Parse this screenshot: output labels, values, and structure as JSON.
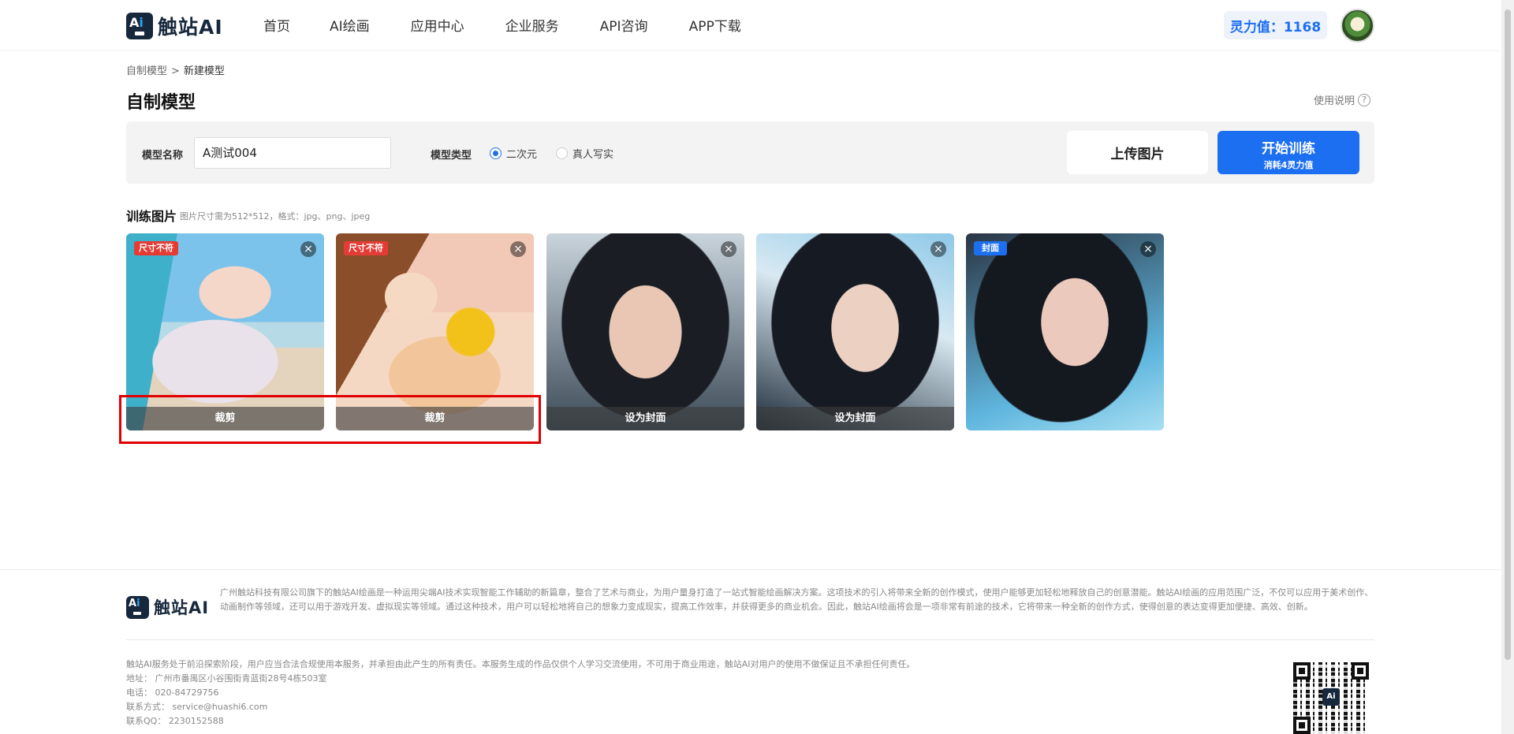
{
  "header": {
    "logo_text": "触站AI",
    "nav": [
      "首页",
      "AI绘画",
      "应用中心",
      "企业服务",
      "API咨询",
      "APP下载"
    ],
    "power_label": "灵力值：1168"
  },
  "breadcrumb": {
    "parent": "自制模型",
    "separator": ">",
    "current": "新建模型"
  },
  "page": {
    "title": "自制模型",
    "usage_link": "使用说明"
  },
  "form": {
    "name_label": "模型名称",
    "name_value": "A测试004",
    "type_label": "模型类型",
    "type_options": [
      "二次元",
      "真人写实"
    ],
    "type_selected": "二次元",
    "upload_label": "上传图片",
    "train_label": "开始训练",
    "train_cost": "消耗4灵力值"
  },
  "training": {
    "title": "训练图片",
    "hint": "图片尺寸需为512*512，格式：jpg、png、jpeg",
    "images": [
      {
        "tag": "尺寸不符",
        "action": "裁剪"
      },
      {
        "tag": "尺寸不符",
        "action": "裁剪"
      },
      {
        "tag": "",
        "action": "设为封面"
      },
      {
        "tag": "",
        "action": "设为封面"
      },
      {
        "tag": "封面",
        "action": ""
      }
    ]
  },
  "footer": {
    "logo_text": "触站AI",
    "description": "广州触站科技有限公司旗下的触站AI绘画是一种运用尖端AI技术实现智能工作辅助的新篇章，整合了艺术与商业，为用户量身打造了一站式智能绘画解决方案。这项技术的引入将带来全新的创作模式，使用户能够更加轻松地释放自己的创意潜能。触站AI绘画的应用范围广泛，不仅可以应用于美术创作、动画制作等领域，还可以用于游戏开发、虚拟现实等领域。通过这种技术，用户可以轻松地将自己的想象力变成现实，提高工作效率，并获得更多的商业机会。因此，触站AI绘画将会是一项非常有前途的技术，它将带来一种全新的创作方式，使得创意的表达变得更加便捷、高效、创新。",
    "disclaimer": "触站AI服务处于前沿探索阶段，用户应当合法合规使用本服务，并承担由此产生的所有责任。本服务生成的作品仅供个人学习交流使用，不可用于商业用途，触站AI对用户的使用不做保证且不承担任何责任。",
    "address": "地址：  广州市番禺区小谷围街青蓝街28号4栋503室",
    "phone": "电话：  020-84729756",
    "email": "联系方式：  service@huashi6.com",
    "qq": "联系QQ：  2230152588"
  }
}
